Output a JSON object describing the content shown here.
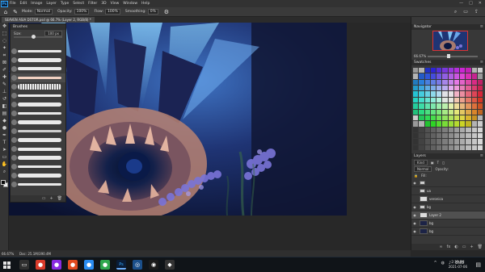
{
  "menu": {
    "items": [
      "File",
      "Edit",
      "Image",
      "Layer",
      "Type",
      "Select",
      "Filter",
      "3D",
      "View",
      "Window",
      "Help"
    ],
    "window_controls": [
      "—",
      "□",
      "✕"
    ]
  },
  "options": {
    "mode_label": "Mode:",
    "mode_value": "Normal",
    "opacity_label": "Opacity:",
    "opacity_value": "100%",
    "flow_label": "Flow:",
    "flow_value": "100%",
    "smoothing_label": "Smoothing:",
    "smoothing_value": "0%"
  },
  "doc_tab": {
    "title": "SEAVEN ASIA DSTOR.psd @ 66.7% (Layer 2, RGB/8) *"
  },
  "brushes_panel": {
    "title": "Brushes",
    "size_label": "Size:",
    "size_value": "100 px"
  },
  "navigator": {
    "title": "Navigator",
    "zoom": "66.67%"
  },
  "swatches": {
    "title": "Swatches"
  },
  "layers": {
    "title": "Layers",
    "kind_label": "Kind",
    "opacity_label": "Opacity:",
    "fill_label": "Fill:",
    "rows": [
      {
        "name": "",
        "type": "folder"
      },
      {
        "name": "ua",
        "type": "folder"
      },
      {
        "name": "veronica",
        "type": "layer"
      },
      {
        "name": "bg",
        "type": "folder"
      },
      {
        "name": "Layer 2",
        "type": "layer"
      },
      {
        "name": "bg",
        "type": "layer"
      },
      {
        "name": "bg",
        "type": "dark"
      }
    ]
  },
  "statusbar": {
    "zoom": "66.67%",
    "doc": "Doc: 25.1M/390.4M"
  },
  "taskbar": {
    "lang": "ENG",
    "time": "2:15 PM",
    "date": "2021-07-06"
  },
  "colors": {
    "accent": "#31a8ff"
  }
}
